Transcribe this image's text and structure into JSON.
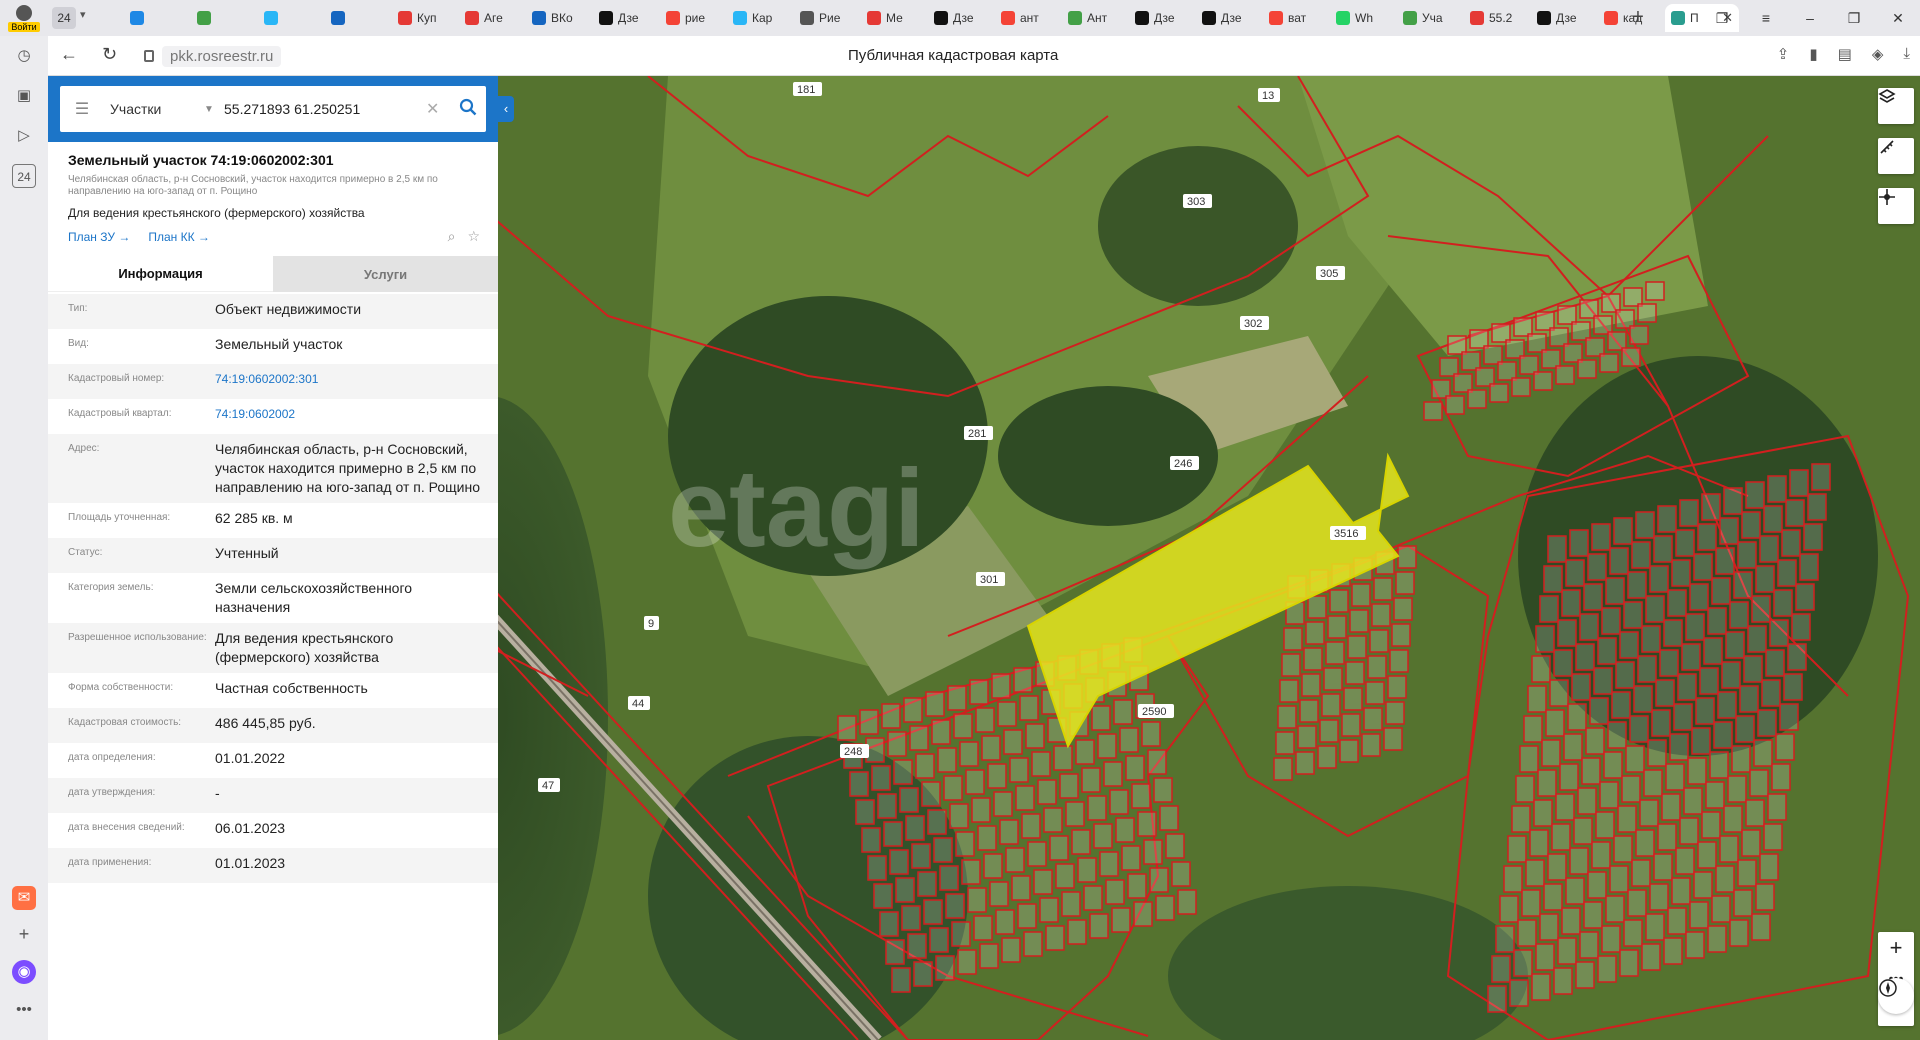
{
  "browser": {
    "login_label": "Войти",
    "tab_count": "24",
    "tabs": [
      {
        "label": "",
        "color": "#1e88e5"
      },
      {
        "label": "",
        "color": "#43a047"
      },
      {
        "label": "",
        "color": "#29b6f6"
      },
      {
        "label": "",
        "color": "#1565c0"
      },
      {
        "label": "Куп",
        "color": "#e53935"
      },
      {
        "label": "Аге",
        "color": "#e53935"
      },
      {
        "label": "ВКо",
        "color": "#1565c0"
      },
      {
        "label": "Дзе",
        "color": "#111111"
      },
      {
        "label": "рие",
        "color": "#f44336"
      },
      {
        "label": "Кар",
        "color": "#29b6f6"
      },
      {
        "label": "Рие",
        "color": "#555555"
      },
      {
        "label": "Ме",
        "color": "#e53935"
      },
      {
        "label": "Дзе",
        "color": "#111111"
      },
      {
        "label": "ант",
        "color": "#f44336"
      },
      {
        "label": "Ант",
        "color": "#43a047"
      },
      {
        "label": "Дзе",
        "color": "#111111"
      },
      {
        "label": "Дзе",
        "color": "#111111"
      },
      {
        "label": "ват",
        "color": "#f44336"
      },
      {
        "label": "Wh",
        "color": "#25d366"
      },
      {
        "label": "Уча",
        "color": "#43a047"
      },
      {
        "label": "55.2",
        "color": "#e53935"
      },
      {
        "label": "Дзе",
        "color": "#111111"
      },
      {
        "label": "кад",
        "color": "#f44336"
      }
    ],
    "active_tab_label": "П",
    "url": "pkk.rosreestr.ru",
    "page_title": "Публичная кадастровая карта",
    "sidebar_counter": "24"
  },
  "search": {
    "layer": "Участки",
    "query": "55.271893 61.250251"
  },
  "parcel": {
    "title": "Земельный участок 74:19:0602002:301",
    "address_short": "Челябинская область, р-н Сосновский, участок находится примерно в 2,5 км по направлению на юго-запад от п. Рощино",
    "use": "Для ведения крестьянского (фермерского) хозяйства",
    "plan_zu": "План ЗУ →",
    "plan_kk": "План КК →"
  },
  "tabs": {
    "info": "Информация",
    "services": "Услуги"
  },
  "rows": [
    {
      "k": "Тип:",
      "v": "Объект недвижимости",
      "link": false
    },
    {
      "k": "Вид:",
      "v": "Земельный участок",
      "link": false
    },
    {
      "k": "Кадастровый номер:",
      "v": "74:19:0602002:301",
      "link": true
    },
    {
      "k": "Кадастровый квартал:",
      "v": "74:19:0602002",
      "link": true
    },
    {
      "k": "Адрес:",
      "v": "Челябинская область, р-н Сосновский, участок находится примерно в 2,5 км по направлению на юго-запад от п. Рощино",
      "link": false
    },
    {
      "k": "Площадь уточненная:",
      "v": "62 285 кв. м",
      "link": false
    },
    {
      "k": "Статус:",
      "v": "Учтенный",
      "link": false
    },
    {
      "k": "Категория земель:",
      "v": "Земли сельскохозяйственного назначения",
      "link": false
    },
    {
      "k": "Разрешенное использование:",
      "v": "Для ведения крестьянского (фермерского) хозяйства",
      "link": false
    },
    {
      "k": "Форма собственности:",
      "v": "Частная собственность",
      "link": false
    },
    {
      "k": "Кадастровая стоимость:",
      "v": "486 445,85 руб.",
      "link": false
    },
    {
      "k": "дата определения:",
      "v": "01.01.2022",
      "link": false
    },
    {
      "k": "дата утверждения:",
      "v": "-",
      "link": false
    },
    {
      "k": "дата внесения сведений:",
      "v": "06.01.2023",
      "link": false
    },
    {
      "k": "дата применения:",
      "v": "01.01.2023",
      "link": false
    }
  ],
  "map": {
    "watermark": "etagi",
    "parcel_labels": [
      "181",
      "13",
      "9",
      "303",
      "305",
      "302",
      "281",
      "246",
      "301",
      "9",
      "44",
      "47",
      "248",
      "2590",
      "3516"
    ],
    "selected_parcel": "301",
    "highlight_color": "#e6e61e",
    "boundary_color": "#d21f1f"
  }
}
